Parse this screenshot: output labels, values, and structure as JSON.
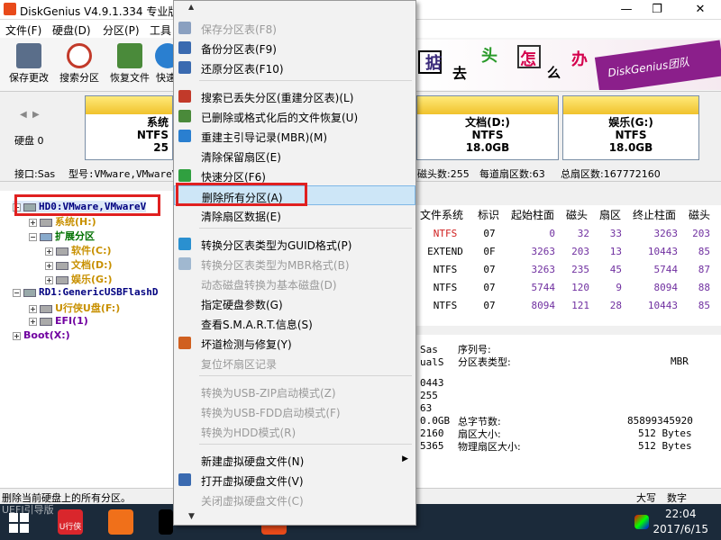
{
  "window": {
    "title": "DiskGenius V4.9.1.334 专业版",
    "minimize": "—",
    "restore": "❐",
    "close": "✕"
  },
  "menubar": {
    "items": [
      "文件(F)",
      "硬盘(D)",
      "分区(P)",
      "工具"
    ]
  },
  "toolbar": {
    "buttons": [
      {
        "label": "保存更改",
        "color": "#5a6e8a"
      },
      {
        "label": "搜索分区",
        "color": "#c23a2a"
      },
      {
        "label": "恢复文件",
        "color": "#4a8a3a"
      },
      {
        "label": "快速",
        "color": "#2a7fd0"
      }
    ]
  },
  "banner": {
    "chars": [
      "掂",
      "去",
      "头",
      "怎",
      "么",
      "办"
    ],
    "tag": "DiskGenius团队"
  },
  "diskbar": {
    "nav_left": "◀",
    "nav_right": "▶",
    "disk_label": "硬盘 0",
    "partitions": [
      {
        "name": "系统",
        "fs": "NTFS",
        "size": "25"
      },
      {
        "name": "文档(D:)",
        "fs": "NTFS",
        "size": "18.0GB"
      },
      {
        "name": "娱乐(G:)",
        "fs": "NTFS",
        "size": "18.0GB"
      }
    ]
  },
  "infobar": {
    "interface": "接口:Sas",
    "model": "型号:VMware,VMwareV",
    "heads": "磁头数:255",
    "sectors_per_track": "每道扇区数:63",
    "total_sectors": "总扇区数:167772160"
  },
  "tree": {
    "items": [
      {
        "label": "HD0:VMware,VMwareV",
        "color": "#000080"
      },
      {
        "label": "系统(H:)",
        "color": "#c89000"
      },
      {
        "label": "扩展分区",
        "color": "#007000"
      },
      {
        "label": "软件(C:)",
        "color": "#c89000"
      },
      {
        "label": "文档(D:)",
        "color": "#c89000"
      },
      {
        "label": "娱乐(G:)",
        "color": "#c89000"
      },
      {
        "label": "RD1:GenericUSBFlashD",
        "color": "#000080"
      },
      {
        "label": "U行侠U盘(F:)",
        "color": "#c89000"
      },
      {
        "label": "EFI(1)",
        "color": "#7000a0"
      },
      {
        "label": "Boot(X:)",
        "color": "#7000a0"
      }
    ]
  },
  "grid": {
    "headers": [
      "文件系统",
      "标识",
      "起始柱面",
      "磁头",
      "扇区",
      "终止柱面",
      "磁头"
    ],
    "rows": [
      {
        "fs": "NTFS",
        "id": "07",
        "start_cyl": "0",
        "head": "32",
        "sector": "33",
        "end_cyl": "3263",
        "end_head": "203",
        "fs_color": "#d02020"
      },
      {
        "fs": "EXTEND",
        "id": "0F",
        "start_cyl": "3263",
        "head": "203",
        "sector": "13",
        "end_cyl": "10443",
        "end_head": "85",
        "fs_color": "#000000"
      },
      {
        "fs": "NTFS",
        "id": "07",
        "start_cyl": "3263",
        "head": "235",
        "sector": "45",
        "end_cyl": "5744",
        "end_head": "87",
        "fs_color": "#000000"
      },
      {
        "fs": "NTFS",
        "id": "07",
        "start_cyl": "5744",
        "head": "120",
        "sector": "9",
        "end_cyl": "8094",
        "end_head": "88",
        "fs_color": "#000000"
      },
      {
        "fs": "NTFS",
        "id": "07",
        "start_cyl": "8094",
        "head": "121",
        "sector": "28",
        "end_cyl": "10443",
        "end_head": "85",
        "fs_color": "#000000"
      }
    ]
  },
  "details": {
    "left_col": [
      "Sas",
      "ualS",
      "",
      "0443",
      "255",
      "63",
      "0.0GB",
      "2160",
      "5365"
    ],
    "serial_label": "序列号:",
    "ptable_label": "分区表类型:",
    "ptable_value": "MBR",
    "total_bytes_label": "总字节数:",
    "total_bytes_value": "85899345920",
    "sector_size_label": "扇区大小:",
    "sector_size_value": "512 Bytes",
    "phys_sector_label": "物理扇区大小:",
    "phys_sector_value": "512 Bytes"
  },
  "statusbar": {
    "text": "删除当前硬盘上的所有分区。",
    "caps": "大写",
    "num": "数字"
  },
  "taskbar": {
    "uefi_text": "UEFI引导版",
    "u_label": "U行侠",
    "time": "22:04",
    "date": "2017/6/15"
  },
  "context_menu": {
    "items": [
      {
        "label": "保存分区表(F8)",
        "disabled": true,
        "icon_color": "#8aa0c0"
      },
      {
        "label": "备份分区表(F9)",
        "disabled": false,
        "icon_color": "#3a6ab0"
      },
      {
        "label": "还原分区表(F10)",
        "disabled": false,
        "icon_color": "#3a6ab0"
      },
      {
        "label": "搜索已丢失分区(重建分区表)(L)",
        "disabled": false,
        "icon_color": "#c23a2a"
      },
      {
        "label": "已删除或格式化后的文件恢复(U)",
        "disabled": false,
        "icon_color": "#4a8a3a"
      },
      {
        "label": "重建主引导记录(MBR)(M)",
        "disabled": false,
        "icon_color": "#2a7fd0"
      },
      {
        "label": "清除保留扇区(E)",
        "disabled": false,
        "icon_color": ""
      },
      {
        "label": "快速分区(F6)",
        "disabled": false,
        "icon_color": "#30a040"
      },
      {
        "label": "删除所有分区(A)",
        "disabled": false,
        "icon_color": ""
      },
      {
        "label": "清除扇区数据(E)",
        "disabled": false,
        "icon_color": ""
      },
      {
        "label": "转换分区表类型为GUID格式(P)",
        "disabled": false,
        "icon_color": "#2a90d0"
      },
      {
        "label": "转换分区表类型为MBR格式(B)",
        "disabled": true,
        "icon_color": "#a0b8d0"
      },
      {
        "label": "动态磁盘转换为基本磁盘(D)",
        "disabled": true,
        "icon_color": ""
      },
      {
        "label": "指定硬盘参数(G)",
        "disabled": false,
        "icon_color": ""
      },
      {
        "label": "查看S.M.A.R.T.信息(S)",
        "disabled": false,
        "icon_color": ""
      },
      {
        "label": "坏道检测与修复(Y)",
        "disabled": false,
        "icon_color": "#d06020"
      },
      {
        "label": "复位坏扇区记录",
        "disabled": true,
        "icon_color": ""
      },
      {
        "label": "转换为USB-ZIP启动模式(Z)",
        "disabled": true,
        "icon_color": ""
      },
      {
        "label": "转换为USB-FDD启动模式(F)",
        "disabled": true,
        "icon_color": ""
      },
      {
        "label": "转换为HDD模式(R)",
        "disabled": true,
        "icon_color": ""
      },
      {
        "label": "新建虚拟硬盘文件(N)",
        "disabled": false,
        "icon_color": "",
        "submenu": "▶"
      },
      {
        "label": "打开虚拟硬盘文件(V)",
        "disabled": false,
        "icon_color": "#3a6ab0"
      },
      {
        "label": "关闭虚拟硬盘文件(C)",
        "disabled": true,
        "icon_color": ""
      }
    ],
    "scroll_up": "▲",
    "scroll_down": "▼"
  }
}
